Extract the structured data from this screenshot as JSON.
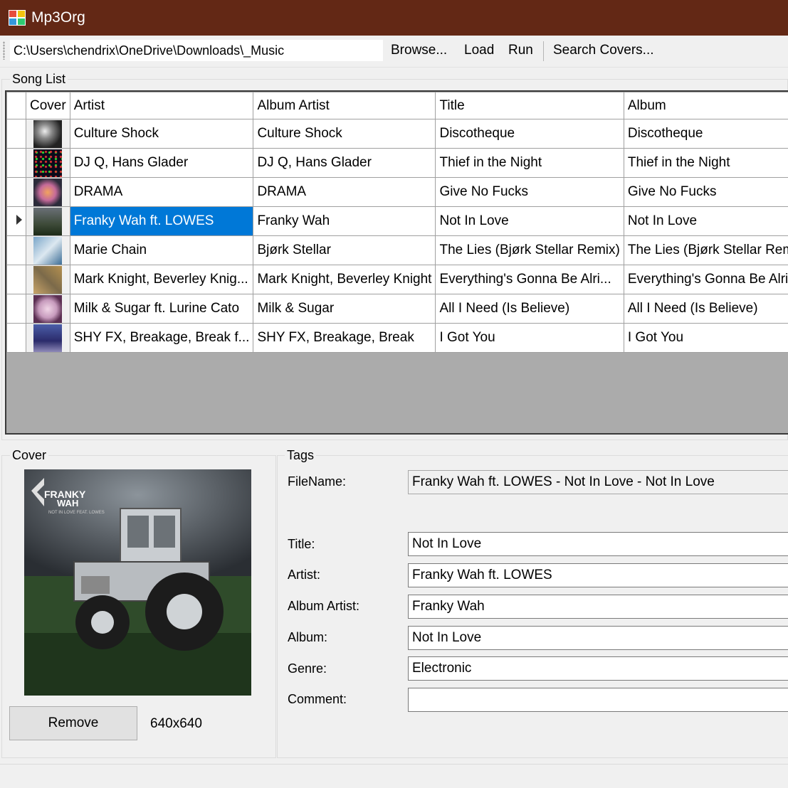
{
  "window": {
    "title": "Mp3Org"
  },
  "toolbar": {
    "path_value": "C:\\Users\\chendrix\\OneDrive\\Downloads\\_Music",
    "browse_label": "Browse...",
    "load_label": "Load",
    "run_label": "Run",
    "search_covers_label": "Search Covers..."
  },
  "song_list": {
    "group_label": "Song List",
    "columns": [
      "Cover",
      "Artist",
      "Album Artist",
      "Title",
      "Album"
    ],
    "selected_row": 3,
    "rows": [
      {
        "artist": "Culture Shock",
        "album_artist": "Culture Shock",
        "title": "Discotheque",
        "album": "Discotheque"
      },
      {
        "artist": "DJ Q, Hans Glader",
        "album_artist": "DJ Q, Hans Glader",
        "title": "Thief in the Night",
        "album": "Thief in the Night"
      },
      {
        "artist": "DRAMA",
        "album_artist": "DRAMA",
        "title": "Give No Fucks",
        "album": "Give No Fucks"
      },
      {
        "artist": "Franky Wah ft. LOWES",
        "album_artist": "Franky Wah",
        "title": "Not In Love",
        "album": "Not In Love"
      },
      {
        "artist": "Marie Chain",
        "album_artist": "Bjørk Stellar",
        "title": "The Lies (Bjørk Stellar Remix)",
        "album": "The Lies (Bjørk Stellar Remix)"
      },
      {
        "artist": "Mark Knight, Beverley Knig...",
        "album_artist": "Mark Knight, Beverley Knight",
        "title": "Everything's Gonna Be Alri...",
        "album": "Everything's Gonna Be Alright"
      },
      {
        "artist": "Milk & Sugar ft. Lurine Cato",
        "album_artist": "Milk & Sugar",
        "title": "All I Need (Is Believe)",
        "album": "All I Need (Is Believe)"
      },
      {
        "artist": "SHY FX, Breakage, Break f...",
        "album_artist": "SHY FX, Breakage, Break",
        "title": "I Got You",
        "album": "I Got You"
      }
    ]
  },
  "cover": {
    "group_label": "Cover",
    "art_text": "FRANKY WAH",
    "art_subtext": "NOT IN LOVE FEAT. LOWES",
    "remove_label": "Remove",
    "dimensions": "640x640"
  },
  "tags": {
    "group_label": "Tags",
    "filename_label": "FileName:",
    "filename_value": "Franky Wah ft. LOWES - Not In Love - Not In Love",
    "title_label": "Title:",
    "title_value": "Not In Love",
    "artist_label": "Artist:",
    "artist_value": "Franky Wah ft. LOWES",
    "album_artist_label": "Album Artist:",
    "album_artist_value": "Franky Wah",
    "album_label": "Album:",
    "album_value": "Not In Love",
    "genre_label": "Genre:",
    "genre_value": "Electronic",
    "comment_label": "Comment:",
    "comment_value": ""
  },
  "colors": {
    "titlebar": "#632815",
    "selection": "#0078d7",
    "grid_empty": "#ababab"
  }
}
